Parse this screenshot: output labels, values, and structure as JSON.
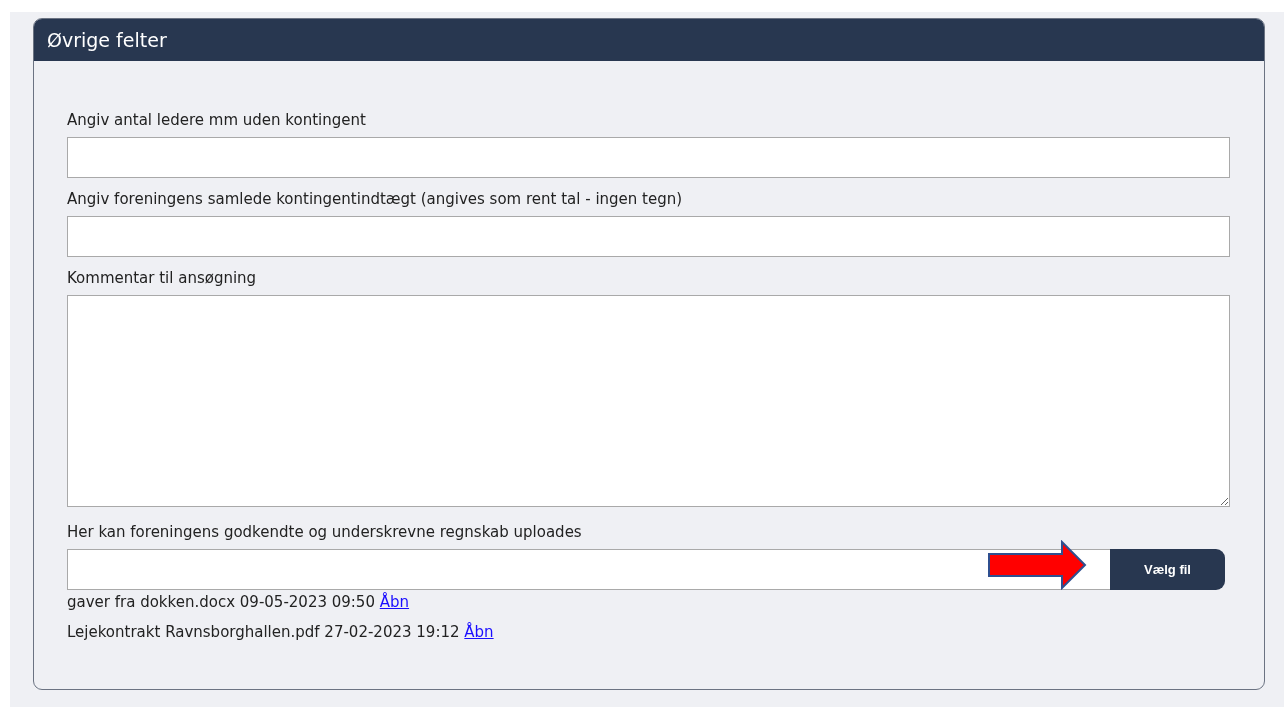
{
  "panel": {
    "title": "Øvrige felter"
  },
  "fields": [
    {
      "kind": "input",
      "label": "Angiv antal ledere mm uden kontingent"
    },
    {
      "kind": "input",
      "label": "Angiv foreningens samlede kontingentindtægt (angives som rent tal - ingen tegn)"
    },
    {
      "kind": "textarea",
      "label": "Kommentar til ansøgning"
    }
  ],
  "upload": {
    "label": "Her kan foreningens godkendte og underskrevne regnskab uploades",
    "button": "Vælg fil"
  },
  "files": [
    {
      "text": "gaver fra dokken.docx 09-05-2023 09:50",
      "link": "Åbn"
    },
    {
      "text": "Lejekontrakt Ravnsborghallen.pdf 27-02-2023 19:12",
      "link": "Åbn"
    }
  ]
}
